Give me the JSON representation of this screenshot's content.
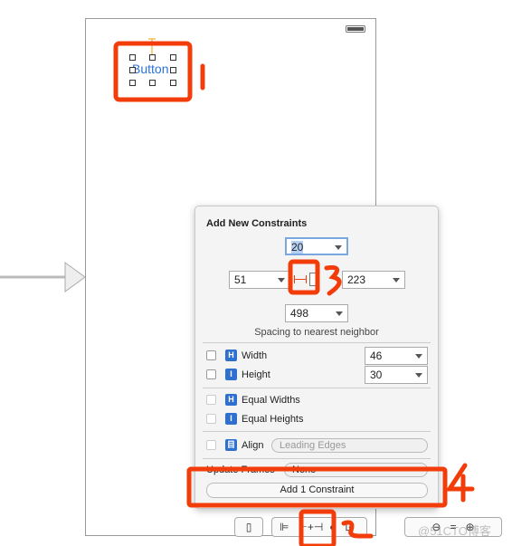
{
  "canvas": {
    "button_label": "Button"
  },
  "popover": {
    "title": "Add New Constraints",
    "spacing": {
      "top": "20",
      "left": "51",
      "right": "223",
      "bottom": "498"
    },
    "spacing_caption": "Spacing to nearest neighbor",
    "width": {
      "label": "Width",
      "value": "46"
    },
    "height": {
      "label": "Height",
      "value": "30"
    },
    "equal_widths": "Equal Widths",
    "equal_heights": "Equal Heights",
    "align": {
      "label": "Align",
      "value": "Leading Edges"
    },
    "update_frames": {
      "label": "Update Frames",
      "value": "None"
    },
    "add_button": "Add 1 Constraint"
  },
  "annotations": [
    "1",
    "2",
    "3",
    "4"
  ],
  "watermark": "@51CTO博客",
  "colors": {
    "annotation": "#f23c0a",
    "accent": "#2f6fd0",
    "button_text": "#2a73d8"
  }
}
